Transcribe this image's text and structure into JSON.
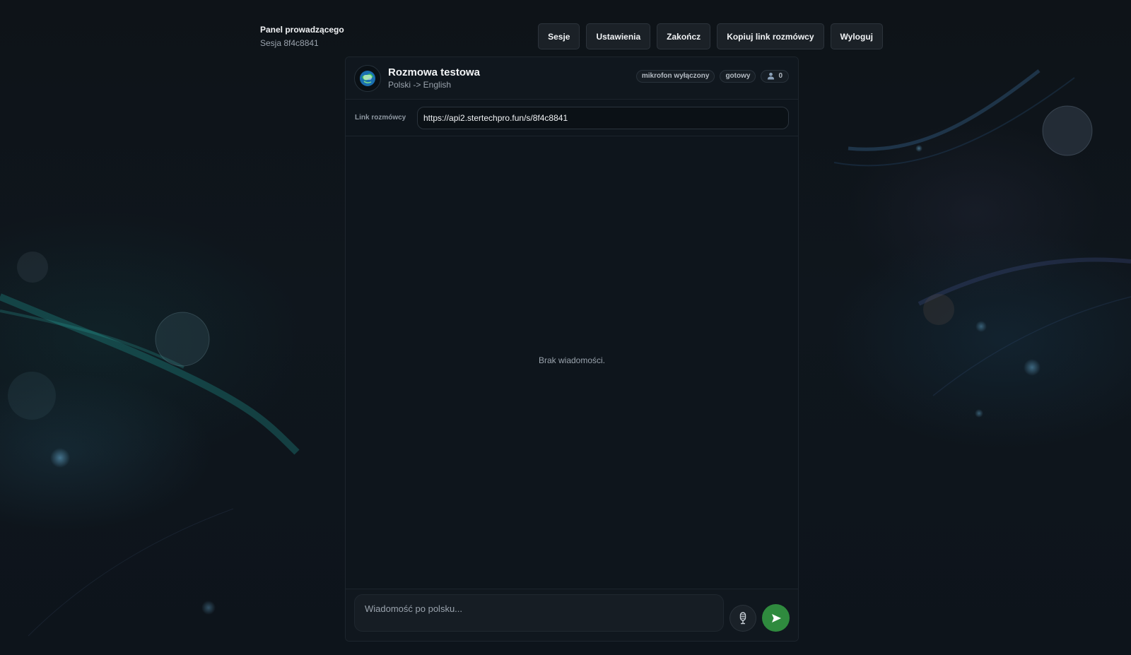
{
  "header": {
    "title": "Panel prowadzącego",
    "session": "Sesja 8f4c8841",
    "nav": [
      {
        "label": "Sesje"
      },
      {
        "label": "Ustawienia"
      },
      {
        "label": "Zakończ"
      },
      {
        "label": "Kopiuj link rozmówcy"
      },
      {
        "label": "Wyloguj"
      }
    ]
  },
  "conversation": {
    "title": "Rozmowa testowa",
    "languages": "Polski -> English",
    "badges": {
      "mic": "mikrofon wyłączony",
      "status": "gotowy",
      "participants": "0"
    },
    "icons": {
      "avatar": "globe-chat-icon",
      "participants": "person-icon",
      "mic": "microphone-icon",
      "send": "send-icon"
    }
  },
  "link_row": {
    "label": "Link rozmówcy",
    "value": "https://api2.stertechpro.fun/s/8f4c8841"
  },
  "messages": {
    "empty_text": "Brak wiadomości."
  },
  "composer": {
    "placeholder": "Wiadomość po polsku..."
  },
  "colors": {
    "background": "#0e1318",
    "panel": "#0e151c",
    "send_button": "#2f8a3e"
  }
}
